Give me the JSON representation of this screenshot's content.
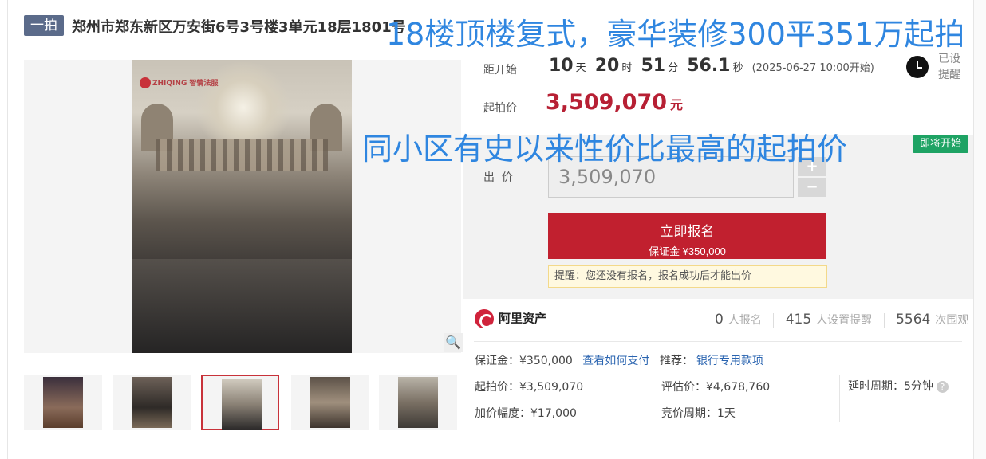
{
  "header": {
    "tag": "一拍",
    "title": "郑州市郑东新区万安街6号3号楼3单元18层1801号",
    "overlay_headline": "18楼顶楼复式，豪华装修300平351万起拍",
    "overlay_sub": "同小区有史以来性价比最高的起拍价"
  },
  "countdown": {
    "label": "距开始",
    "days": "10",
    "days_unit": "天",
    "hours": "20",
    "hours_unit": "时",
    "minutes": "51",
    "minutes_unit": "分",
    "seconds": "56.1",
    "seconds_unit": "秒",
    "start_time": "(2025-06-27 10:00开始)"
  },
  "reminder": {
    "label_line1": "已设",
    "label_line2": "提醒",
    "icon": "alarm-clock-icon"
  },
  "start_price": {
    "label": "起拍价",
    "value": "3,509,070",
    "unit": "元"
  },
  "status_badge": "即将开始",
  "bid": {
    "label": "出  价",
    "value": "3,509,070",
    "plus": "+",
    "minus": "−"
  },
  "signup_button": {
    "line1": "立即报名",
    "line2": "保证金 ¥350,000"
  },
  "tip": "提醒：您还没有报名，报名成功后才能出价",
  "platform": {
    "name": "阿里资产",
    "logo_icon": "ali-assets-logo-icon"
  },
  "stats": {
    "signups": "0",
    "signups_label": "人报名",
    "reminders": "415",
    "reminders_label": "人设置提醒",
    "views": "5564",
    "views_label": "次围观"
  },
  "details": {
    "deposit": "保证金：¥350,000",
    "how_to_pay": "查看如何支付",
    "recommend_label": "推荐：",
    "recommend_value": "银行专用款项",
    "start_price": "起拍价：¥3,509,070",
    "appraisal": "评估价：¥4,678,760",
    "delay_period": "延时周期：5分钟",
    "increment": "加价幅度：¥17,000",
    "bidding_period": "竞价周期：1天",
    "help_icon": "?"
  },
  "gallery": {
    "watermark": "ZHIQING 智情法服",
    "zoom_icon": "magnifier-icon",
    "thumb_count": 5,
    "active_thumb": 3
  }
}
